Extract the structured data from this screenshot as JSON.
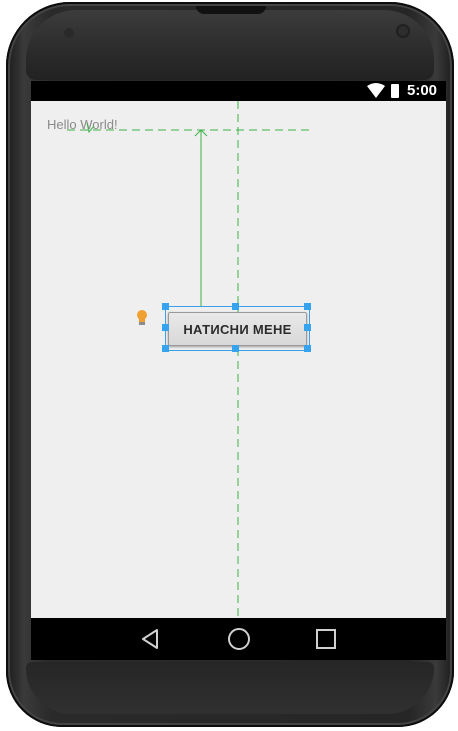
{
  "device": "Nexus 4 emulator",
  "status_bar": {
    "time": "5:00",
    "icons": [
      "wifi-icon",
      "battery-icon"
    ]
  },
  "app": {
    "hello_text": "Hello World!",
    "button_label": "НАТИСНИ МЕНЕ"
  },
  "nav_bar": {
    "icons": [
      "back-icon",
      "home-icon",
      "recents-icon"
    ]
  },
  "colors": {
    "background": "#efefef",
    "guide_green": "#3db34a",
    "selection_blue": "#36a3ee",
    "bulb": "#f0a030"
  }
}
